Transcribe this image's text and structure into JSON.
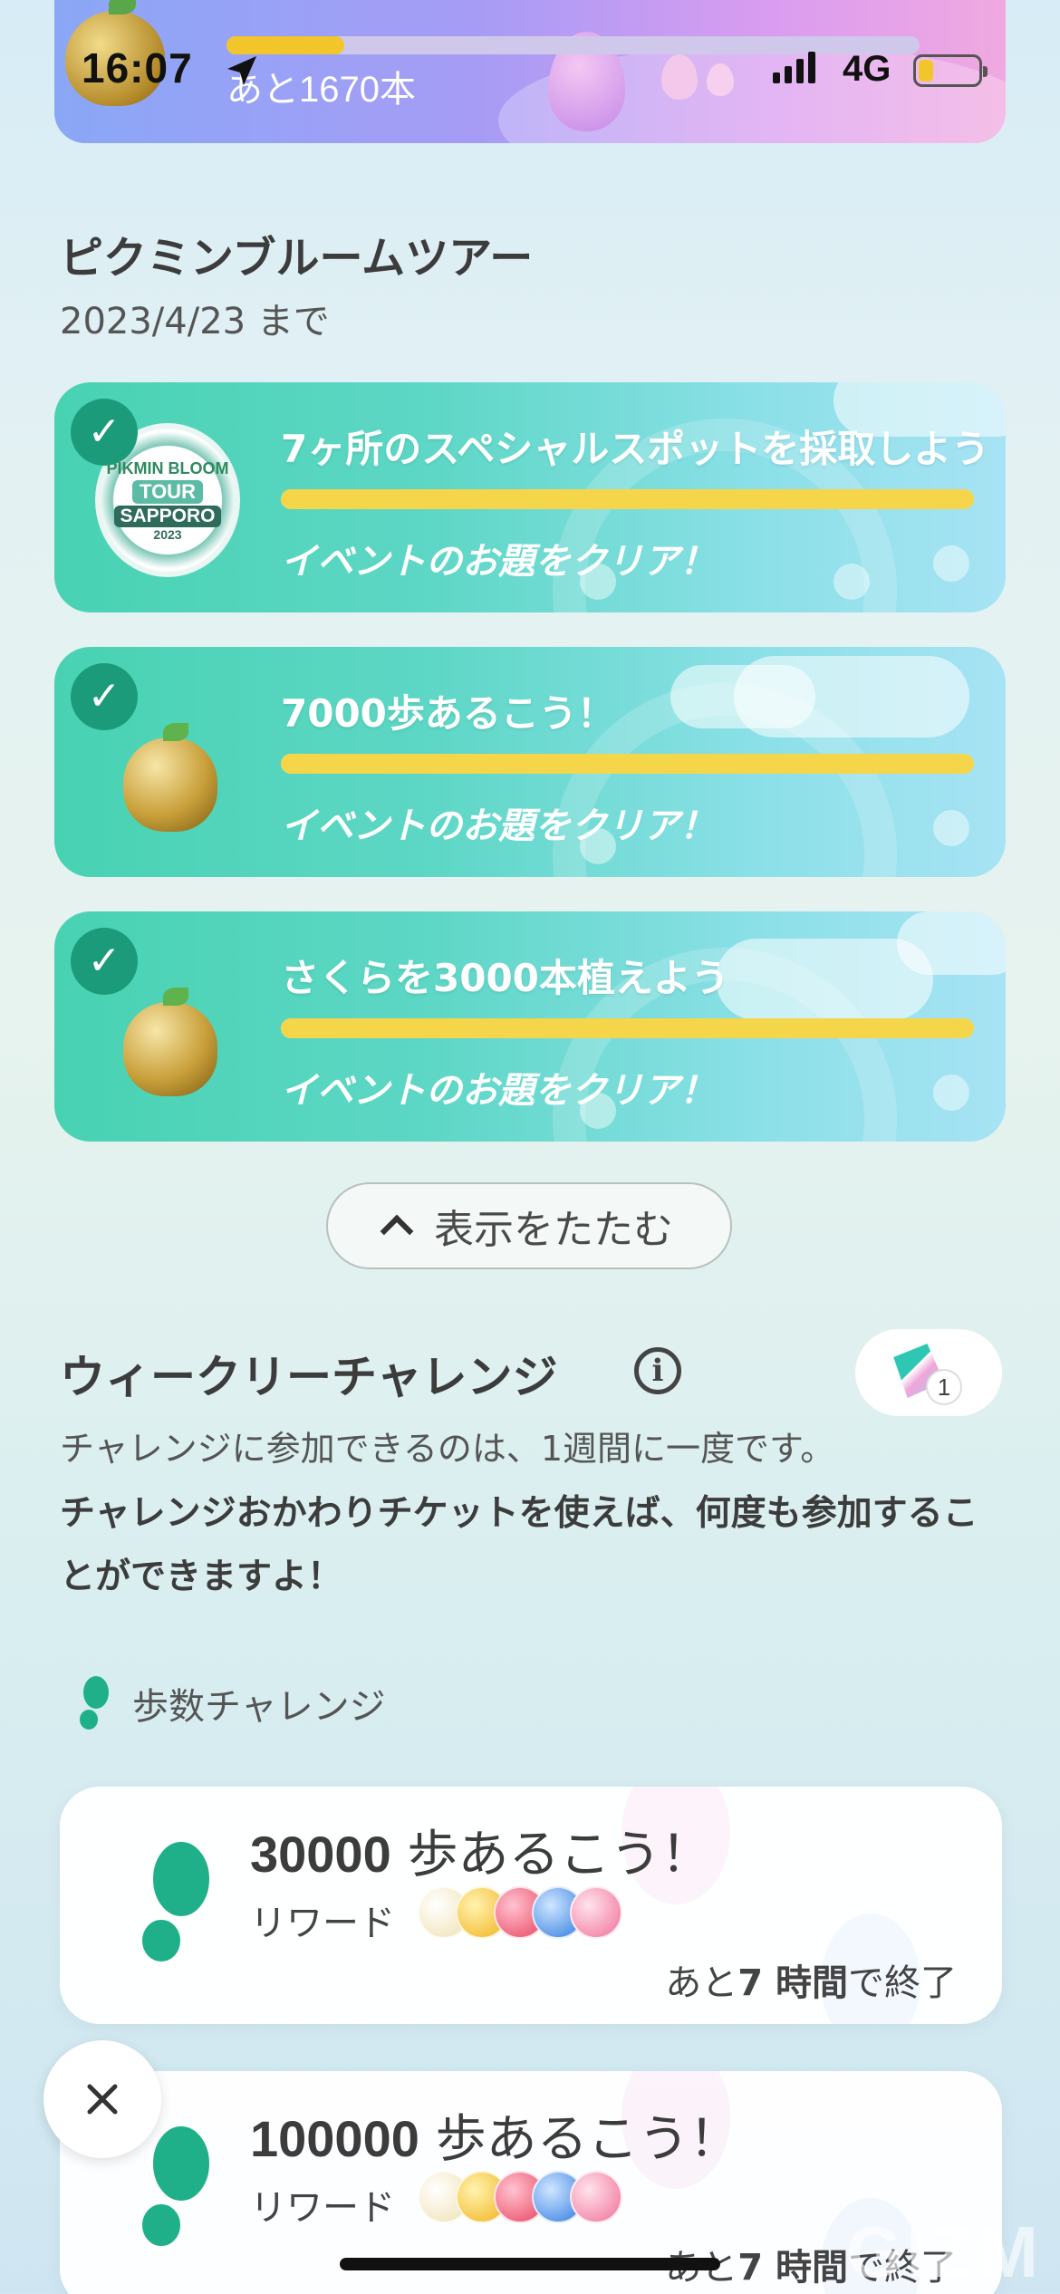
{
  "status_bar": {
    "time": "16:07",
    "network": "4G",
    "battery_level": 0.25,
    "signal_bars": 4
  },
  "top_banner": {
    "remaining_text": "あと1670本",
    "progress": 0.17
  },
  "tour": {
    "title": "ピクミンブルームツアー",
    "deadline": "2023/4/23 まで",
    "badge": {
      "line1": "PIKMIN BLOOM",
      "line2": "TOUR",
      "line3": "SAPPORO",
      "line4": "2023"
    },
    "events": [
      {
        "title": "7ヶ所のスペシャルスポットを採取しよう",
        "status": "イベントのお題をクリア！",
        "progress": 1.0,
        "completed": true,
        "icon": "sapporo-tour-badge-icon"
      },
      {
        "title": "7000歩あるこう！",
        "status": "イベントのお題をクリア！",
        "progress": 1.0,
        "completed": true,
        "icon": "golden-pot-icon"
      },
      {
        "title": "さくらを3000本植えよう",
        "status": "イベントのお題をクリア！",
        "progress": 1.0,
        "completed": true,
        "icon": "golden-pot-icon"
      }
    ]
  },
  "collapse_button": {
    "label": "表示をたたむ"
  },
  "weekly": {
    "title": "ウィークリーチャレンジ",
    "description": "チャレンジに参加できるのは、1週間に一度です。",
    "bold_description": "チャレンジおかわりチケットを使えば、何度も参加することができますよ！",
    "ticket_count": "1",
    "category_label": "歩数チャレンジ",
    "challenges": [
      {
        "goal": "30000",
        "suffix": " 歩あるこう！",
        "reward_label": "リワード",
        "time_prefix": "あと",
        "time_value": "7 時間",
        "time_suffix": "で終了"
      },
      {
        "goal": "100000",
        "suffix": " 歩あるこう！",
        "reward_label": "リワード",
        "time_prefix": "あと",
        "time_value": "7 時間",
        "time_suffix": "で終了"
      }
    ]
  },
  "colors": {
    "accent_green": "#1c9b7a",
    "progress_yellow": "#f5d54a",
    "footprint_green": "#1fb08a"
  },
  "watermark": "GIZM"
}
